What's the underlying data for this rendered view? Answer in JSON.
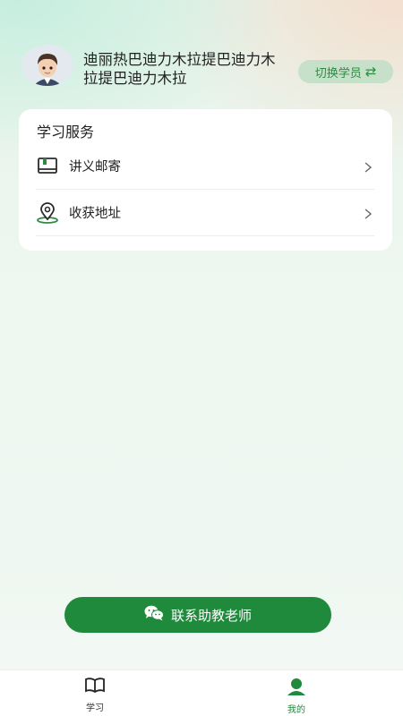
{
  "profile": {
    "name": "迪丽热巴迪力木拉提巴迪力木拉提巴迪力木拉",
    "switch_label": "切换学员",
    "switch_icon": "swap-arrows-icon"
  },
  "service_card": {
    "title": "学习服务",
    "items": [
      {
        "label": "讲义邮寄",
        "icon": "book-icon"
      },
      {
        "label": "收获地址",
        "icon": "location-pin-icon"
      }
    ]
  },
  "contact_button": {
    "label": "联系助教老师",
    "icon": "wechat-icon"
  },
  "tabbar": {
    "tabs": [
      {
        "label": "学习",
        "icon": "open-book-icon",
        "active": false
      },
      {
        "label": "我的",
        "icon": "person-icon",
        "active": true
      }
    ]
  },
  "colors": {
    "accent": "#1f8a3b",
    "switch_bg": "#bedec6",
    "text": "#222222"
  }
}
